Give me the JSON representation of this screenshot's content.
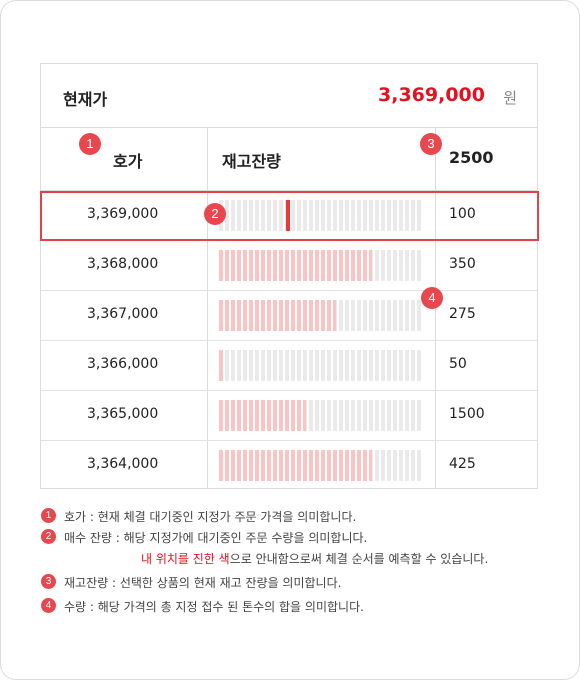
{
  "header": {
    "title": "현재가",
    "price": "3,369,000",
    "unit": "원"
  },
  "columns": {
    "price_label": "호가",
    "stock_label": "재고잔량",
    "qty_label": "2500"
  },
  "rows": [
    {
      "price": "3,369,000",
      "qty": "100",
      "fill": 0,
      "marker": 0.33
    },
    {
      "price": "3,368,000",
      "qty": "350",
      "fill": 0.75,
      "marker": null
    },
    {
      "price": "3,367,000",
      "qty": "275",
      "fill": 0.575,
      "marker": null
    },
    {
      "price": "3,366,000",
      "qty": "50",
      "fill": 0.02,
      "marker": null
    },
    {
      "price": "3,365,000",
      "qty": "1500",
      "fill": 0.425,
      "marker": null
    },
    {
      "price": "3,364,000",
      "qty": "425",
      "fill": 0.75,
      "marker": null
    }
  ],
  "badges": [
    "1",
    "2",
    "3",
    "4"
  ],
  "notes": {
    "n1": "호가 : 현재 체결 대기중인 지정가 주문 가격을 의미합니다.",
    "n2": "매수 잔량 : 해당 지정가에 대기중인 주문 수량을 의미합니다.",
    "n2b_red": "내 위치를 진한 색",
    "n2b_rest": "으로 안내함으로써 체결 순서를 예측할 수 있습니다.",
    "n3": "재고잔량 : 선택한 상품의 현재 재고 잔량을 의미합니다.",
    "n4": "수량 : 해당 가격의 총 지정 접수 된 톤수의 합을 의미합니다."
  },
  "colors": {
    "accent": "#e8101e",
    "badge": "#e8474e",
    "bar_fill": "#fac4c4",
    "bar_track": "#eaeaea",
    "marker": "#e83a3a"
  }
}
